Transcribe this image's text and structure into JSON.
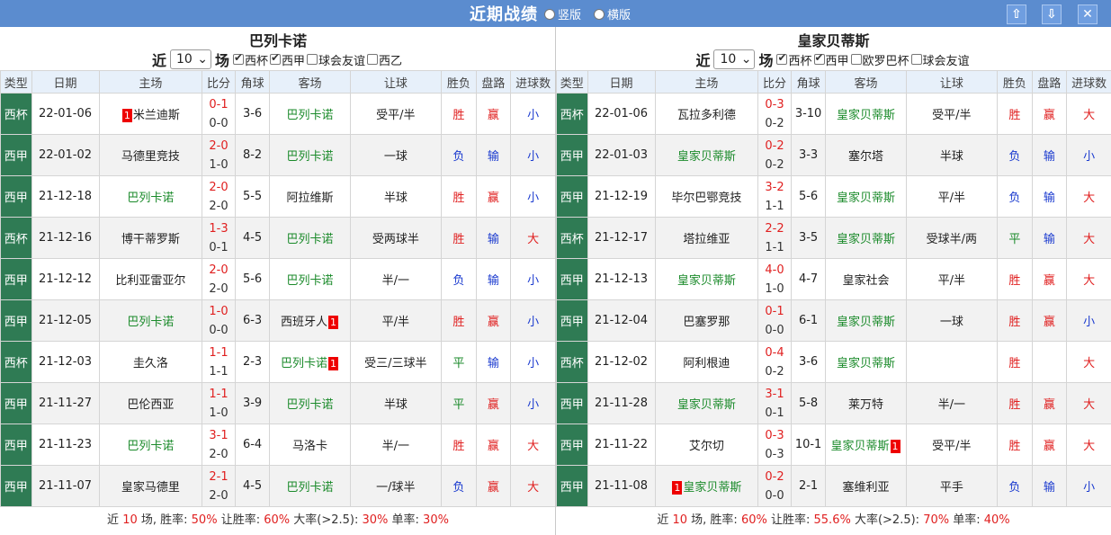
{
  "title": "近期战绩",
  "layout_options": [
    {
      "label": "竖版",
      "selected": false
    },
    {
      "label": "横版",
      "selected": false
    }
  ],
  "buttons": {
    "up": "⇧",
    "down": "⇩",
    "close": "✕"
  },
  "columns": [
    "类型",
    "日期",
    "主场",
    "比分",
    "角球",
    "客场",
    "让球",
    "胜负",
    "盘路",
    "进球数"
  ],
  "left": {
    "team": "巴列卡诺",
    "near": "近",
    "count": "10",
    "chang": "场",
    "filters": [
      {
        "label": "西杯",
        "checked": true
      },
      {
        "label": "西甲",
        "checked": true
      },
      {
        "label": "球会友谊",
        "checked": false
      },
      {
        "label": "西乙",
        "checked": false
      }
    ],
    "rows": [
      {
        "type": "西杯",
        "date": "22-01-06",
        "home": "米兰迪斯",
        "home_red": "1",
        "home_team": false,
        "ft": "0-1",
        "ht": "0-0",
        "corner": "3-6",
        "away": "巴列卡诺",
        "away_red": "",
        "away_team": true,
        "hcp": "受平/半",
        "wl": "胜",
        "wl_c": "red",
        "pan": "赢",
        "pan_c": "red",
        "goals": "小",
        "goals_c": "blue"
      },
      {
        "type": "西甲",
        "date": "22-01-02",
        "home": "马德里竞技",
        "home_red": "",
        "home_team": false,
        "ft": "2-0",
        "ht": "1-0",
        "corner": "8-2",
        "away": "巴列卡诺",
        "away_red": "",
        "away_team": true,
        "hcp": "一球",
        "wl": "负",
        "wl_c": "blue",
        "pan": "输",
        "pan_c": "blue",
        "goals": "小",
        "goals_c": "blue"
      },
      {
        "type": "西甲",
        "date": "21-12-18",
        "home": "巴列卡诺",
        "home_red": "",
        "home_team": true,
        "ft": "2-0",
        "ht": "2-0",
        "corner": "5-5",
        "away": "阿拉维斯",
        "away_red": "",
        "away_team": false,
        "hcp": "半球",
        "wl": "胜",
        "wl_c": "red",
        "pan": "赢",
        "pan_c": "red",
        "goals": "小",
        "goals_c": "blue"
      },
      {
        "type": "西杯",
        "date": "21-12-16",
        "home": "博干蒂罗斯",
        "home_red": "",
        "home_team": false,
        "ft": "1-3",
        "ht": "0-1",
        "corner": "4-5",
        "away": "巴列卡诺",
        "away_red": "",
        "away_team": true,
        "hcp": "受两球半",
        "wl": "胜",
        "wl_c": "red",
        "pan": "输",
        "pan_c": "blue",
        "goals": "大",
        "goals_c": "red"
      },
      {
        "type": "西甲",
        "date": "21-12-12",
        "home": "比利亚雷亚尔",
        "home_red": "",
        "home_team": false,
        "ft": "2-0",
        "ht": "2-0",
        "corner": "5-6",
        "away": "巴列卡诺",
        "away_red": "",
        "away_team": true,
        "hcp": "半/一",
        "wl": "负",
        "wl_c": "blue",
        "pan": "输",
        "pan_c": "blue",
        "goals": "小",
        "goals_c": "blue"
      },
      {
        "type": "西甲",
        "date": "21-12-05",
        "home": "巴列卡诺",
        "home_red": "",
        "home_team": true,
        "ft": "1-0",
        "ht": "0-0",
        "corner": "6-3",
        "away": "西班牙人",
        "away_red": "1",
        "away_team": false,
        "hcp": "平/半",
        "wl": "胜",
        "wl_c": "red",
        "pan": "赢",
        "pan_c": "red",
        "goals": "小",
        "goals_c": "blue"
      },
      {
        "type": "西杯",
        "date": "21-12-03",
        "home": "圭久洛",
        "home_red": "",
        "home_team": false,
        "ft": "1-1",
        "ht": "1-1",
        "corner": "2-3",
        "away": "巴列卡诺",
        "away_red": "1",
        "away_team": true,
        "hcp": "受三/三球半",
        "wl": "平",
        "wl_c": "green",
        "pan": "输",
        "pan_c": "blue",
        "goals": "小",
        "goals_c": "blue"
      },
      {
        "type": "西甲",
        "date": "21-11-27",
        "home": "巴伦西亚",
        "home_red": "",
        "home_team": false,
        "ft": "1-1",
        "ht": "1-0",
        "corner": "3-9",
        "away": "巴列卡诺",
        "away_red": "",
        "away_team": true,
        "hcp": "半球",
        "wl": "平",
        "wl_c": "green",
        "pan": "赢",
        "pan_c": "red",
        "goals": "小",
        "goals_c": "blue"
      },
      {
        "type": "西甲",
        "date": "21-11-23",
        "home": "巴列卡诺",
        "home_red": "",
        "home_team": true,
        "ft": "3-1",
        "ht": "2-0",
        "corner": "6-4",
        "away": "马洛卡",
        "away_red": "",
        "away_team": false,
        "hcp": "半/一",
        "wl": "胜",
        "wl_c": "red",
        "pan": "赢",
        "pan_c": "red",
        "goals": "大",
        "goals_c": "red"
      },
      {
        "type": "西甲",
        "date": "21-11-07",
        "home": "皇家马德里",
        "home_red": "",
        "home_team": false,
        "ft": "2-1",
        "ht": "2-0",
        "corner": "4-5",
        "away": "巴列卡诺",
        "away_red": "",
        "away_team": true,
        "hcp": "一/球半",
        "wl": "负",
        "wl_c": "blue",
        "pan": "赢",
        "pan_c": "red",
        "goals": "大",
        "goals_c": "red"
      }
    ],
    "summary": {
      "p1": "近 ",
      "n": "10",
      "p2": " 场, 胜率: ",
      "win": "50%",
      "p3": " 让胜率: ",
      "hcp": "60%",
      "p4": " 大率(>2.5): ",
      "big": "30%",
      "p5": " 单率: ",
      "odd": "30%"
    }
  },
  "right": {
    "team": "皇家贝蒂斯",
    "near": "近",
    "count": "10",
    "chang": "场",
    "filters": [
      {
        "label": "西杯",
        "checked": true
      },
      {
        "label": "西甲",
        "checked": true
      },
      {
        "label": "欧罗巴杯",
        "checked": false
      },
      {
        "label": "球会友谊",
        "checked": false
      }
    ],
    "rows": [
      {
        "type": "西杯",
        "date": "22-01-06",
        "home": "瓦拉多利德",
        "home_red": "",
        "home_team": false,
        "ft": "0-3",
        "ht": "0-2",
        "corner": "3-10",
        "away": "皇家贝蒂斯",
        "away_red": "",
        "away_team": true,
        "hcp": "受平/半",
        "wl": "胜",
        "wl_c": "red",
        "pan": "赢",
        "pan_c": "red",
        "goals": "大",
        "goals_c": "red"
      },
      {
        "type": "西甲",
        "date": "22-01-03",
        "home": "皇家贝蒂斯",
        "home_red": "",
        "home_team": true,
        "ft": "0-2",
        "ht": "0-2",
        "corner": "3-3",
        "away": "塞尔塔",
        "away_red": "",
        "away_team": false,
        "hcp": "半球",
        "wl": "负",
        "wl_c": "blue",
        "pan": "输",
        "pan_c": "blue",
        "goals": "小",
        "goals_c": "blue"
      },
      {
        "type": "西甲",
        "date": "21-12-19",
        "home": "毕尔巴鄂竞技",
        "home_red": "",
        "home_team": false,
        "ft": "3-2",
        "ht": "1-1",
        "corner": "5-6",
        "away": "皇家贝蒂斯",
        "away_red": "",
        "away_team": true,
        "hcp": "平/半",
        "wl": "负",
        "wl_c": "blue",
        "pan": "输",
        "pan_c": "blue",
        "goals": "大",
        "goals_c": "red"
      },
      {
        "type": "西杯",
        "date": "21-12-17",
        "home": "塔拉维亚",
        "home_red": "",
        "home_team": false,
        "ft": "2-2",
        "ht": "1-1",
        "corner": "3-5",
        "away": "皇家贝蒂斯",
        "away_red": "",
        "away_team": true,
        "hcp": "受球半/两",
        "wl": "平",
        "wl_c": "green",
        "pan": "输",
        "pan_c": "blue",
        "goals": "大",
        "goals_c": "red"
      },
      {
        "type": "西甲",
        "date": "21-12-13",
        "home": "皇家贝蒂斯",
        "home_red": "",
        "home_team": true,
        "ft": "4-0",
        "ht": "1-0",
        "corner": "4-7",
        "away": "皇家社会",
        "away_red": "",
        "away_team": false,
        "hcp": "平/半",
        "wl": "胜",
        "wl_c": "red",
        "pan": "赢",
        "pan_c": "red",
        "goals": "大",
        "goals_c": "red"
      },
      {
        "type": "西甲",
        "date": "21-12-04",
        "home": "巴塞罗那",
        "home_red": "",
        "home_team": false,
        "ft": "0-1",
        "ht": "0-0",
        "corner": "6-1",
        "away": "皇家贝蒂斯",
        "away_red": "",
        "away_team": true,
        "hcp": "一球",
        "wl": "胜",
        "wl_c": "red",
        "pan": "赢",
        "pan_c": "red",
        "goals": "小",
        "goals_c": "blue"
      },
      {
        "type": "西杯",
        "date": "21-12-02",
        "home": "阿利根迪",
        "home_red": "",
        "home_team": false,
        "ft": "0-4",
        "ht": "0-2",
        "corner": "3-6",
        "away": "皇家贝蒂斯",
        "away_red": "",
        "away_team": true,
        "hcp": "",
        "wl": "胜",
        "wl_c": "red",
        "pan": "",
        "pan_c": "red",
        "goals": "大",
        "goals_c": "red"
      },
      {
        "type": "西甲",
        "date": "21-11-28",
        "home": "皇家贝蒂斯",
        "home_red": "",
        "home_team": true,
        "ft": "3-1",
        "ht": "0-1",
        "corner": "5-8",
        "away": "莱万特",
        "away_red": "",
        "away_team": false,
        "hcp": "半/一",
        "wl": "胜",
        "wl_c": "red",
        "pan": "赢",
        "pan_c": "red",
        "goals": "大",
        "goals_c": "red"
      },
      {
        "type": "西甲",
        "date": "21-11-22",
        "home": "艾尔切",
        "home_red": "",
        "home_team": false,
        "ft": "0-3",
        "ht": "0-3",
        "corner": "10-1",
        "away": "皇家贝蒂斯",
        "away_red": "1",
        "away_team": true,
        "hcp": "受平/半",
        "wl": "胜",
        "wl_c": "red",
        "pan": "赢",
        "pan_c": "red",
        "goals": "大",
        "goals_c": "red"
      },
      {
        "type": "西甲",
        "date": "21-11-08",
        "home": "皇家贝蒂斯",
        "home_red": "1",
        "home_team": true,
        "ft": "0-2",
        "ht": "0-0",
        "corner": "2-1",
        "away": "塞维利亚",
        "away_red": "",
        "away_team": false,
        "hcp": "平手",
        "wl": "负",
        "wl_c": "blue",
        "pan": "输",
        "pan_c": "blue",
        "goals": "小",
        "goals_c": "blue"
      }
    ],
    "summary": {
      "p1": "近 ",
      "n": "10",
      "p2": " 场, 胜率: ",
      "win": "60%",
      "p3": " 让胜率: ",
      "hcp": "55.6%",
      "p4": " 大率(>2.5): ",
      "big": "70%",
      "p5": " 单率: ",
      "odd": "40%"
    }
  }
}
